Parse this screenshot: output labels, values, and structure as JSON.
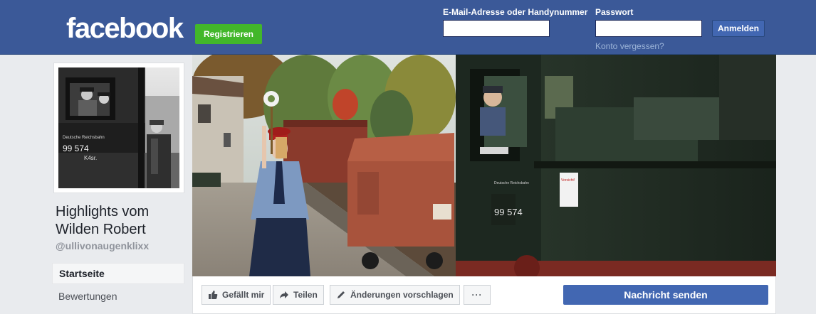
{
  "header": {
    "logo": "facebook",
    "register_label": "Registrieren",
    "email_label": "E-Mail-Adresse oder Handynummer",
    "email_value": "",
    "password_label": "Passwort",
    "password_value": "",
    "login_label": "Anmelden",
    "forgot_label": "Konto vergessen?"
  },
  "page": {
    "name": "Highlights vom Wilden Robert",
    "handle": "@ullivonaugenklixx",
    "profile_photo_text": [
      "Deutsche Reichsbahn",
      "99 574",
      "K4sr."
    ]
  },
  "nav": {
    "items": [
      {
        "label": "Startseite",
        "active": true
      },
      {
        "label": "Bewertungen",
        "active": false
      }
    ]
  },
  "cover": {
    "locomotive_number": "99 574",
    "plate_text": "Deutsche Reichsbahn",
    "warning_sign": "Vorsicht!"
  },
  "actions": {
    "like_label": "Gefällt mir",
    "share_label": "Teilen",
    "suggest_label": "Änderungen vorschlagen",
    "more_label": "···",
    "message_label": "Nachricht senden"
  },
  "colors": {
    "brand": "#3b5998",
    "register_green": "#42b72a",
    "button_blue": "#4267b2"
  }
}
